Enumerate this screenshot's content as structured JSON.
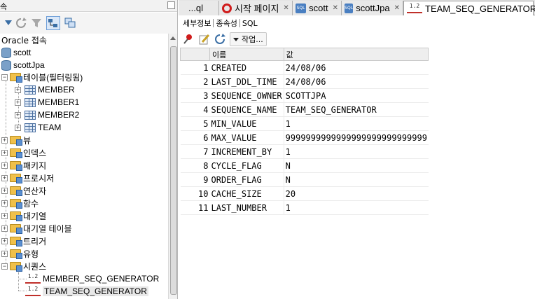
{
  "navigator": {
    "clipped_title": "속",
    "connections_label": "Oracle 접속",
    "tree": [
      {
        "label": "scott",
        "icon": "database-icon"
      },
      {
        "label": "scottJpa",
        "icon": "database-icon"
      },
      {
        "label": "테이블(필터링됨)",
        "icon": "folder-icon"
      },
      {
        "label": "MEMBER",
        "icon": "table-icon"
      },
      {
        "label": "MEMBER1",
        "icon": "table-icon"
      },
      {
        "label": "MEMBER2",
        "icon": "table-icon"
      },
      {
        "label": "TEAM",
        "icon": "table-icon"
      },
      {
        "label": "뷰",
        "icon": "folder-icon"
      },
      {
        "label": "인덱스",
        "icon": "folder-icon"
      },
      {
        "label": "패키지",
        "icon": "folder-icon"
      },
      {
        "label": "프로시저",
        "icon": "folder-icon"
      },
      {
        "label": "연산자",
        "icon": "folder-icon"
      },
      {
        "label": "함수",
        "icon": "folder-icon"
      },
      {
        "label": "대기열",
        "icon": "folder-icon"
      },
      {
        "label": "대기열 테이블",
        "icon": "folder-icon"
      },
      {
        "label": "트리거",
        "icon": "folder-icon"
      },
      {
        "label": "유형",
        "icon": "folder-icon"
      },
      {
        "label": "시퀀스",
        "icon": "folder-icon"
      },
      {
        "label": "MEMBER_SEQ_GENERATOR",
        "icon": "sequence-icon"
      },
      {
        "label": "TEAM_SEQ_GENERATOR",
        "icon": "sequence-icon"
      }
    ]
  },
  "tabs": [
    {
      "label": "...ql",
      "icon": "none"
    },
    {
      "label": "시작 페이지",
      "icon": "oracle-icon"
    },
    {
      "label": "scott",
      "icon": "sql-worksheet-icon"
    },
    {
      "label": "scottJpa",
      "icon": "sql-worksheet-icon"
    },
    {
      "label": "TEAM_SEQ_GENERATOR",
      "icon": "sequence-icon"
    }
  ],
  "subtabs": [
    "세부정보",
    "종속성",
    "SQL"
  ],
  "toolbar": {
    "actions_label": "작업..."
  },
  "sequence_icon_text": "1.2",
  "sql_icon_text": "SQL",
  "grid": {
    "headers": [
      "이름",
      "값"
    ],
    "rows": [
      {
        "n": "1",
        "name": "CREATED",
        "value": "24/08/06"
      },
      {
        "n": "2",
        "name": "LAST_DDL_TIME",
        "value": "24/08/06"
      },
      {
        "n": "3",
        "name": "SEQUENCE_OWNER",
        "value": "SCOTTJPA"
      },
      {
        "n": "4",
        "name": "SEQUENCE_NAME",
        "value": "TEAM_SEQ_GENERATOR"
      },
      {
        "n": "5",
        "name": "MIN_VALUE",
        "value": "1"
      },
      {
        "n": "6",
        "name": "MAX_VALUE",
        "value": "9999999999999999999999999999"
      },
      {
        "n": "7",
        "name": "INCREMENT_BY",
        "value": "1"
      },
      {
        "n": "8",
        "name": "CYCLE_FLAG",
        "value": "N"
      },
      {
        "n": "9",
        "name": "ORDER_FLAG",
        "value": "N"
      },
      {
        "n": "10",
        "name": "CACHE_SIZE",
        "value": "20"
      },
      {
        "n": "11",
        "name": "LAST_NUMBER",
        "value": "1"
      }
    ]
  },
  "colors": {
    "oracle_red": "#d01c1c",
    "folder": "#f0c04a",
    "sequence_red": "#c0302a"
  }
}
